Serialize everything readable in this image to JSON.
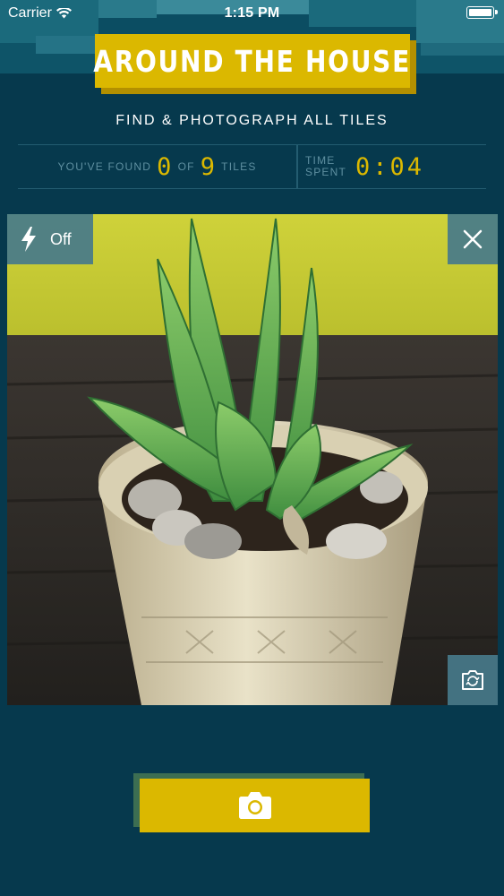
{
  "status_bar": {
    "carrier": "Carrier",
    "time": "1:15 PM",
    "wifi_icon": "wifi-icon",
    "battery_icon": "battery-icon"
  },
  "header": {
    "title": "AROUND THE HOUSE",
    "subtitle": "FIND & PHOTOGRAPH ALL TILES"
  },
  "stats": {
    "found_prefix": "YOU'VE FOUND",
    "found_count": "0",
    "of_label": "OF",
    "total_count": "9",
    "tiles_label": "TILES",
    "time_label_line1": "TIME",
    "time_label_line2": "SPENT",
    "time_value": "0:04"
  },
  "camera": {
    "flash_label": "Off",
    "flash_icon": "lightning-bolt-icon",
    "close_icon": "close-icon",
    "switch_icon": "camera-switch-icon"
  },
  "shutter": {
    "icon": "camera-icon"
  },
  "colors": {
    "background": "#06394d",
    "accent": "#dbb800",
    "muted_text": "#5e8fa0",
    "overlay_button": "#477a8a"
  }
}
